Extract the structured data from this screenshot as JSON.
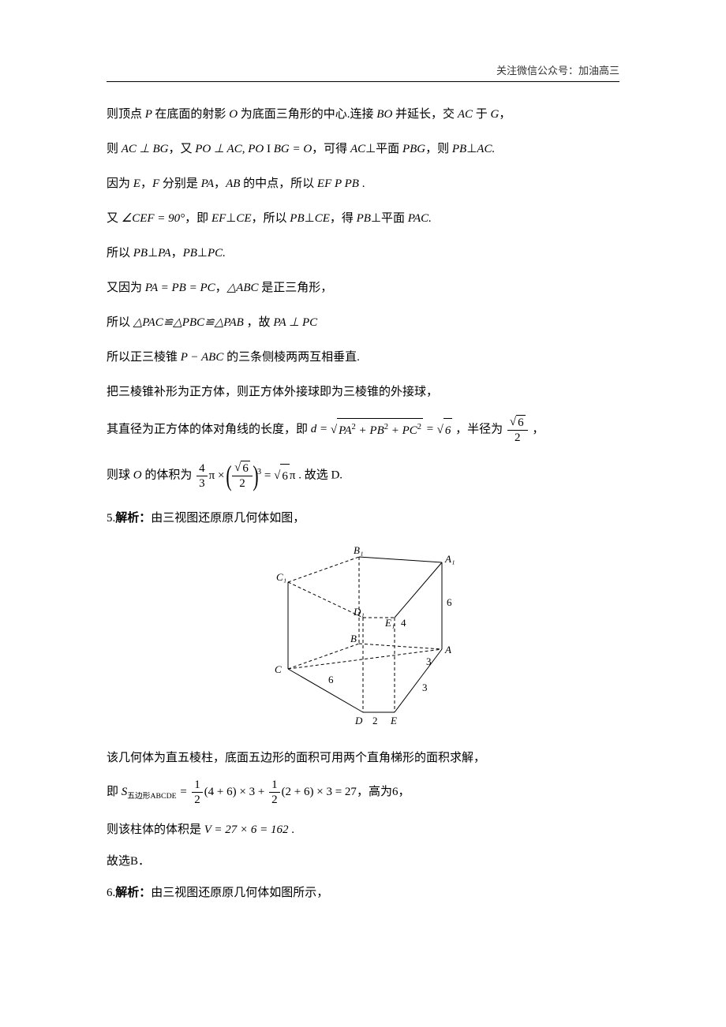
{
  "header": {
    "text": "关注微信公众号：加油高三"
  },
  "lines": {
    "l1_a": "则顶点 ",
    "l1_b": "P ",
    "l1_c": "在底面的射影 ",
    "l1_d": "O ",
    "l1_e": "为底面三角形的中心.连接 ",
    "l1_f": "BO ",
    "l1_g": "并延长，交 ",
    "l1_h": "AC ",
    "l1_i": "于 ",
    "l1_j": "G",
    "l1_k": "，",
    "l2_a": "则 ",
    "l2_b": "AC ⊥ BG",
    "l2_c": "，又 ",
    "l2_d": "PO ⊥ AC, PO",
    "l2_e": " I ",
    "l2_f": "BG = O",
    "l2_g": "，可得 ",
    "l2_h": "AC",
    "l2_i": "⊥平面 ",
    "l2_j": "PBG",
    "l2_k": "，则 ",
    "l2_l": "PB",
    "l2_m": "⊥",
    "l2_n": "AC.",
    "l3_a": "因为 ",
    "l3_b": "E",
    "l3_c": "，",
    "l3_d": "F ",
    "l3_e": "分别是 ",
    "l3_f": "PA",
    "l3_g": "，",
    "l3_h": "AB ",
    "l3_i": "的中点，所以 ",
    "l3_j": "EF P PB",
    "l3_k": " .",
    "l4_a": "又 ",
    "l4_b": "∠CEF = 90°",
    "l4_c": "，即 ",
    "l4_d": "EF",
    "l4_e": "⊥",
    "l4_f": "CE",
    "l4_g": "，所以 ",
    "l4_h": "PB",
    "l4_i": "⊥",
    "l4_j": "CE",
    "l4_k": "，得 ",
    "l4_l": "PB",
    "l4_m": "⊥平面 ",
    "l4_n": "PAC.",
    "l5_a": "所以 ",
    "l5_b": "PB",
    "l5_c": "⊥",
    "l5_d": "PA",
    "l5_e": "，",
    "l5_f": "PB",
    "l5_g": "⊥",
    "l5_h": "PC.",
    "l6_a": "又因为 ",
    "l6_b": "PA = PB = PC",
    "l6_c": "，",
    "l6_d": "△ABC",
    "l6_e": " 是正三角形，",
    "l7_a": "所以 ",
    "l7_b": "△PAC≌△PBC≌△PAB",
    "l7_c": " ，故 ",
    "l7_d": "PA ⊥ PC",
    "l8_a": "所以正三棱锥 ",
    "l8_b": "P − ABC",
    "l8_c": " 的三条侧棱两两互相垂直.",
    "l9": "把三棱锥补形为正方体，则正方体外接球即为三棱锥的外接球，",
    "l10_a": "其直径为正方体的体对角线的长度，即 ",
    "l10_d": "d = ",
    "l10_pa": "PA",
    "l10_plus1": " + ",
    "l10_pb": "PB",
    "l10_plus2": " + ",
    "l10_pc": "PC",
    "l10_eq": " = ",
    "l10_six": "6",
    "l10_mid": "，半径为 ",
    "l10_num": "6",
    "l10_den": "2",
    "l10_end": "，",
    "l11_a": "则球 ",
    "l11_b": "O ",
    "l11_c": "的体积为 ",
    "l11_n1": "4",
    "l11_d1": "3",
    "l11_pi1": "π × ",
    "l11_pn": "6",
    "l11_pd": "2",
    "l11_exp": "3",
    "l11_eq": " = ",
    "l11_r6": "6",
    "l11_pi2": "π",
    "l11_end": " .  故选 D.",
    "l12_a": "5.",
    "l12_b": "解析：",
    "l12_c": "由三视图还原原几何体如图，",
    "diagram": {
      "A1": "A₁",
      "B1": "B₁",
      "C1": "C₁",
      "D1": "D₁",
      "E1": "E₁",
      "A": "A",
      "B": "B",
      "C": "C",
      "D": "D",
      "E": "E",
      "n6a": "6",
      "n6b": "6",
      "n4": "4",
      "n3a": "3",
      "n3b": "3",
      "n2": "2"
    },
    "l13": "该几何体为直五棱柱，底面五边形的面积可用两个直角梯形的面积求解，",
    "l14_a": "即 ",
    "l14_sub": "五边形ABCDE",
    "l14_mid": " = ",
    "l14_f1n": "1",
    "l14_f1d": "2",
    "l14_p1": "(4 + 6) × 3 + ",
    "l14_f2n": "1",
    "l14_f2d": "2",
    "l14_p2": "(2 + 6) × 3 = 27",
    "l14_end": "，高为6，",
    "l15_a": "则该柱体的体积是 ",
    "l15_b": "V = 27 × 6 = 162",
    "l15_c": " .",
    "l16": "故选B．",
    "l17_a": "6.",
    "l17_b": "解析：",
    "l17_c": "由三视图还原原几何体如图所示，"
  },
  "chart_data": {
    "type": "table",
    "description": "3D pentagonal prism with labeled vertices and edge lengths",
    "vertices_top": [
      "A1",
      "B1",
      "C1",
      "D1",
      "E1"
    ],
    "vertices_bottom": [
      "A",
      "B",
      "C",
      "D",
      "E"
    ],
    "edge_lengths": {
      "AA1": 6,
      "CD": 6,
      "E1A": 4,
      "AE_right": 3,
      "ED_bottom_right": 3,
      "DE": 2
    },
    "computed": {
      "pentagon_area": 27,
      "height": 6,
      "volume": 162
    }
  }
}
